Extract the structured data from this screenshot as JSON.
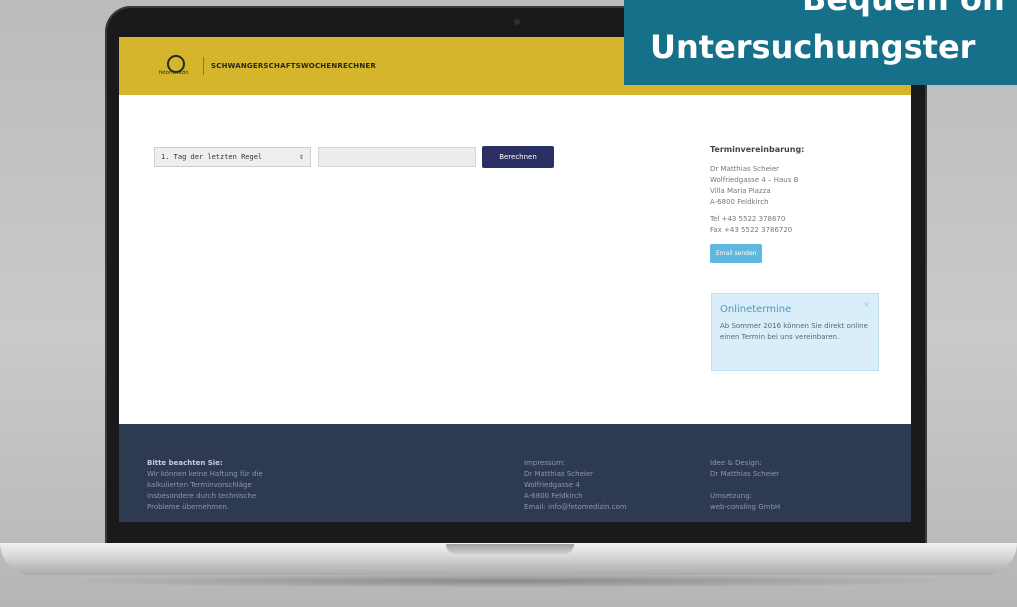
{
  "header": {
    "logo_text": "fetomedizin",
    "title": "SCHWANGERSCHAFTSWOCHENRECHNER"
  },
  "form": {
    "select_value": "1. Tag der letzten Regel",
    "select_arrow": "⇕",
    "date_value": "",
    "button_label": "Berechnen"
  },
  "sidebar": {
    "heading": "Terminvereinbarung:",
    "address": [
      "Dr Matthias Scheier",
      "Wolfriedgasse 4 – Haus B",
      "Villa Maria Piazza",
      "A-6800 Feldkirch"
    ],
    "phone": "Tel +43 5522 378670",
    "fax": "Fax +43 5522 3786720",
    "email_button": "Email senden"
  },
  "online_box": {
    "title": "Onlinetermine",
    "close": "×",
    "text": "Ab Sommer 2016 können Sie direkt online einen Termin bei uns vereinbaren."
  },
  "footer": {
    "col1": {
      "heading": "Bitte beachten Sie:",
      "lines": [
        "Wir können keine Haftung für die",
        "kalkulierten Terminvorschläge",
        "insbesondere durch technische",
        "Probleme übernehmen."
      ]
    },
    "col2": {
      "lines": [
        "Impressum:",
        "Dr Matthias Scheier",
        "Wolfriedgasse 4",
        "A-6800 Feldkirch",
        "Email: info@fetomedizin.com"
      ]
    },
    "col3": {
      "lines": [
        "Idee & Design:",
        "Dr Matthias Scheier",
        "",
        "Umsetzung:",
        "web-consling GmbH"
      ]
    }
  },
  "promo": {
    "line1": "Bequem on",
    "line2": "Untersuchungster"
  }
}
